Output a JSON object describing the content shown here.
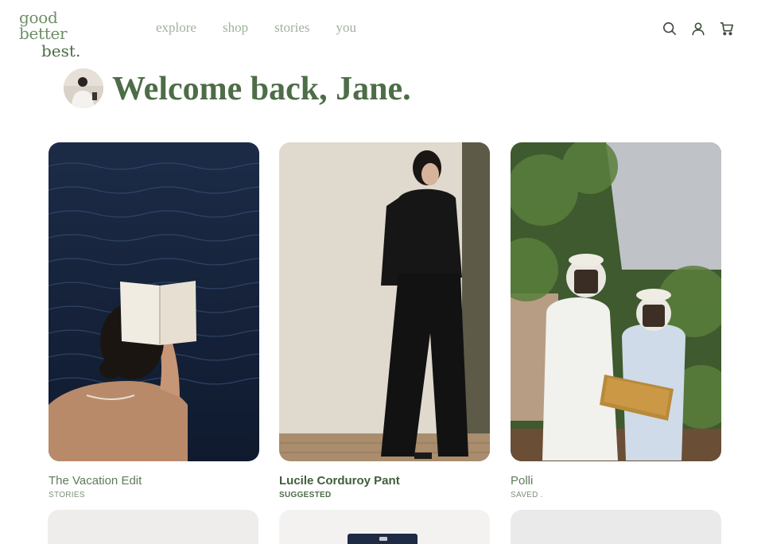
{
  "brand": {
    "line1": "good better",
    "line2": "best."
  },
  "nav": [
    "explore",
    "shop",
    "stories",
    "you"
  ],
  "header_icons": [
    "search-icon",
    "user-icon",
    "cart-icon"
  ],
  "welcome": "Welcome back, Jane.",
  "cards": [
    {
      "title": "The Vacation Edit",
      "category": "STORIES"
    },
    {
      "title": "Lucile Corduroy Pant",
      "category": "SUGGESTED"
    },
    {
      "title": "Polli",
      "category": "SAVED ."
    }
  ],
  "colors": {
    "brand_green": "#4d6d47",
    "nav_muted": "#9fb39a"
  }
}
